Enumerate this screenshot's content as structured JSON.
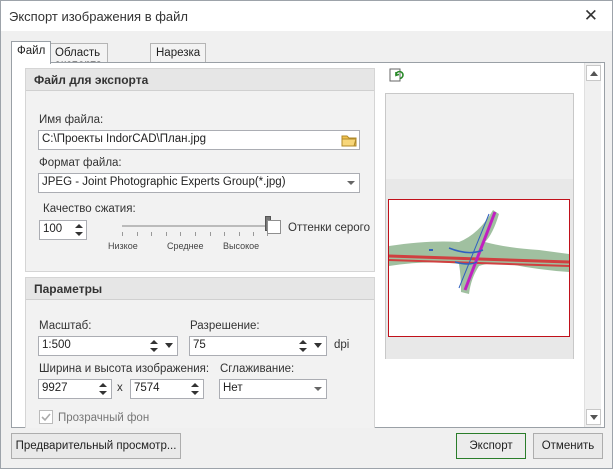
{
  "window": {
    "title": "Экспорт изображения в файл",
    "close_label": "✕"
  },
  "tabs": [
    {
      "label": "Файл"
    },
    {
      "label": "Область экспорта"
    },
    {
      "label": "Нарезка"
    }
  ],
  "file_group": {
    "header": "Файл для экспорта",
    "filename_label": "Имя файла:",
    "filename_value": "C:\\Проекты IndorCAD\\План.jpg",
    "format_label": "Формат файла:",
    "format_value": "JPEG - Joint Photographic Experts Group(*.jpg)",
    "quality_label": "Качество сжатия:",
    "quality_value": "100",
    "quality_level": 1.0,
    "slider_labels": {
      "low": "Низкое",
      "mid": "Среднее",
      "high": "Высокое"
    },
    "grayscale_label": "Оттенки серого",
    "grayscale_checked": false
  },
  "params_group": {
    "header": "Параметры",
    "scale_label": "Масштаб:",
    "scale_value": "1:500",
    "resolution_label": "Разрешение:",
    "resolution_value": "75",
    "resolution_unit": "dpi",
    "size_label": "Ширина и высота изображения:",
    "width_value": "9927",
    "times": "x",
    "height_value": "7574",
    "smoothing_label": "Сглаживание:",
    "smoothing_value": "Нет",
    "transparent_label": "Прозрачный фон",
    "transparent_checked": true
  },
  "footer": {
    "preview_button": "Предварительный просмотр...",
    "export_button": "Экспорт",
    "cancel_button": "Отменить"
  },
  "colors": {
    "accent_green": "#2a7d2a",
    "preview_border": "#c0101a",
    "map_green": "#8fb58f",
    "road_red": "#d04040",
    "road_magenta": "#c020c0"
  },
  "icons": {
    "refresh": "refresh-preview-icon",
    "folder": "folder-open-icon",
    "close": "close-icon"
  }
}
